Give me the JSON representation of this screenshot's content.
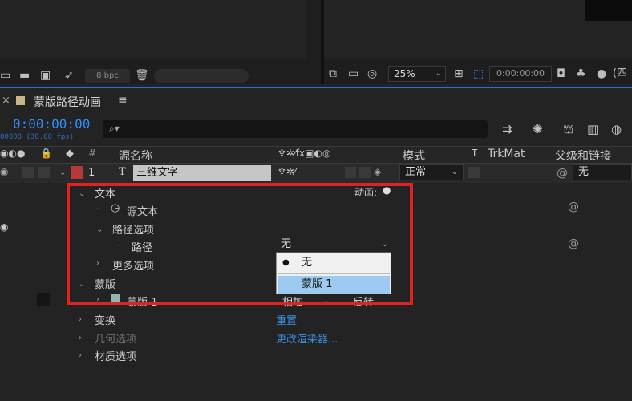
{
  "toolbar": {
    "bit_depth": "8 bpc",
    "zoom": "25%",
    "preview_timecode": "0:00:00:00",
    "view_label": "(四"
  },
  "composition": {
    "tab_close": "×",
    "tab_title": "蒙版路径动画",
    "tab_menu": "≡",
    "timecode": "0:00:00:00",
    "fps": "00000 (30.00 fps)",
    "search_placeholder": "⌕▾"
  },
  "columns": {
    "number": "#",
    "source_name": "源名称",
    "mode": "模式",
    "track_t": "T",
    "trkmat": "TrkMat",
    "parent": "父级和链接"
  },
  "layer": {
    "index": "1",
    "type_glyph": "T",
    "name": "三维文字",
    "mode": "正常",
    "parent": "无"
  },
  "properties": {
    "text": "文本",
    "animate": "动画:",
    "source_text": "源文本",
    "path_options": "路径选项",
    "path": "路径",
    "path_value": "无",
    "more_options": "更多选项",
    "masks": "蒙版",
    "mask_1": "蒙版 1",
    "mask_mode": "相加",
    "mask_invert": "反转",
    "transform": "变换",
    "transform_action": "重置",
    "geometry_options": "几何选项",
    "geometry_action": "更改渲染器...",
    "material_options": "材质选项"
  },
  "dropdown_menu": {
    "items": [
      "无",
      "蒙版 1"
    ],
    "selected": "无",
    "hovered": "蒙版 1"
  },
  "colors": {
    "accent_blue": "#2f8fff",
    "highlight_red": "#e02222",
    "layer_label": "#b33a36",
    "menu_hover": "#9ccaf0"
  }
}
